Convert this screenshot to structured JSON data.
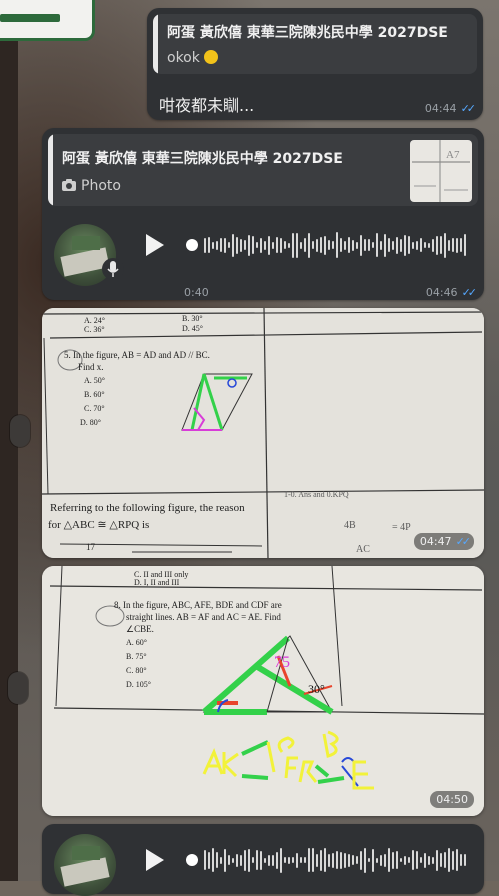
{
  "messages": [
    {
      "reply_name": "阿蛋 黃欣僖 東華三院陳兆民中學 2027DSE",
      "reply_text": "okok",
      "text": "咁夜都未瞓...",
      "time": "04:44"
    },
    {
      "reply_name": "阿蛋 黃欣僖 東華三院陳兆民中學 2027DSE",
      "reply_text": "Photo",
      "duration": "0:40",
      "time": "04:46"
    },
    {
      "time": "04:47",
      "paper": {
        "opt_a": "A. 24°",
        "opt_b": "B. 30°",
        "opt_c": "C. 36°",
        "opt_d": "D. 45°",
        "q5_line1": "5.  In the figure, AB = AD and AD // BC.",
        "q5_line2": "Find x.",
        "q5_a": "A.  50°",
        "q5_b": "B.  60°",
        "q5_c": "C.  70°",
        "q5_d": "D.  80°",
        "ref_line1": "Referring to the following figure, the reason",
        "ref_line2": "for △ABC ≅ △RPQ is",
        "note_1": "1-0. Ans and 0.KPQ",
        "note_2": "4B",
        "note_3": "= 4P",
        "note_4": "AC",
        "label_17": "17"
      }
    },
    {
      "time": "04:50",
      "paper": {
        "top_c": "C.  II and III only",
        "top_d": "D.  I, II and III",
        "q8_line1": "8.  In the figure, ABC, AFE, BDE and CDF are",
        "q8_line2": "straight lines.  AB = AF and AC = AE.  Find",
        "q8_line3": "∠CBE.",
        "q8_a": "A.  60°",
        "q8_b": "B.  75°",
        "q8_c": "C.  80°",
        "q8_d": "D.  105°",
        "angle_30": "30°",
        "angle_75": "75"
      }
    }
  ],
  "colors": {
    "bubble": "#2f3134",
    "tick_read": "#55a8ff",
    "highlight_green": "#33d14a",
    "highlight_yellow": "#f2f23a",
    "highlight_red": "#e8442c",
    "highlight_blue": "#2748d8",
    "highlight_magenta": "#d83cd8"
  },
  "icons": [
    "camera-icon",
    "play-icon",
    "microphone-icon",
    "double-check-icon",
    "smirk-emoji-icon"
  ]
}
